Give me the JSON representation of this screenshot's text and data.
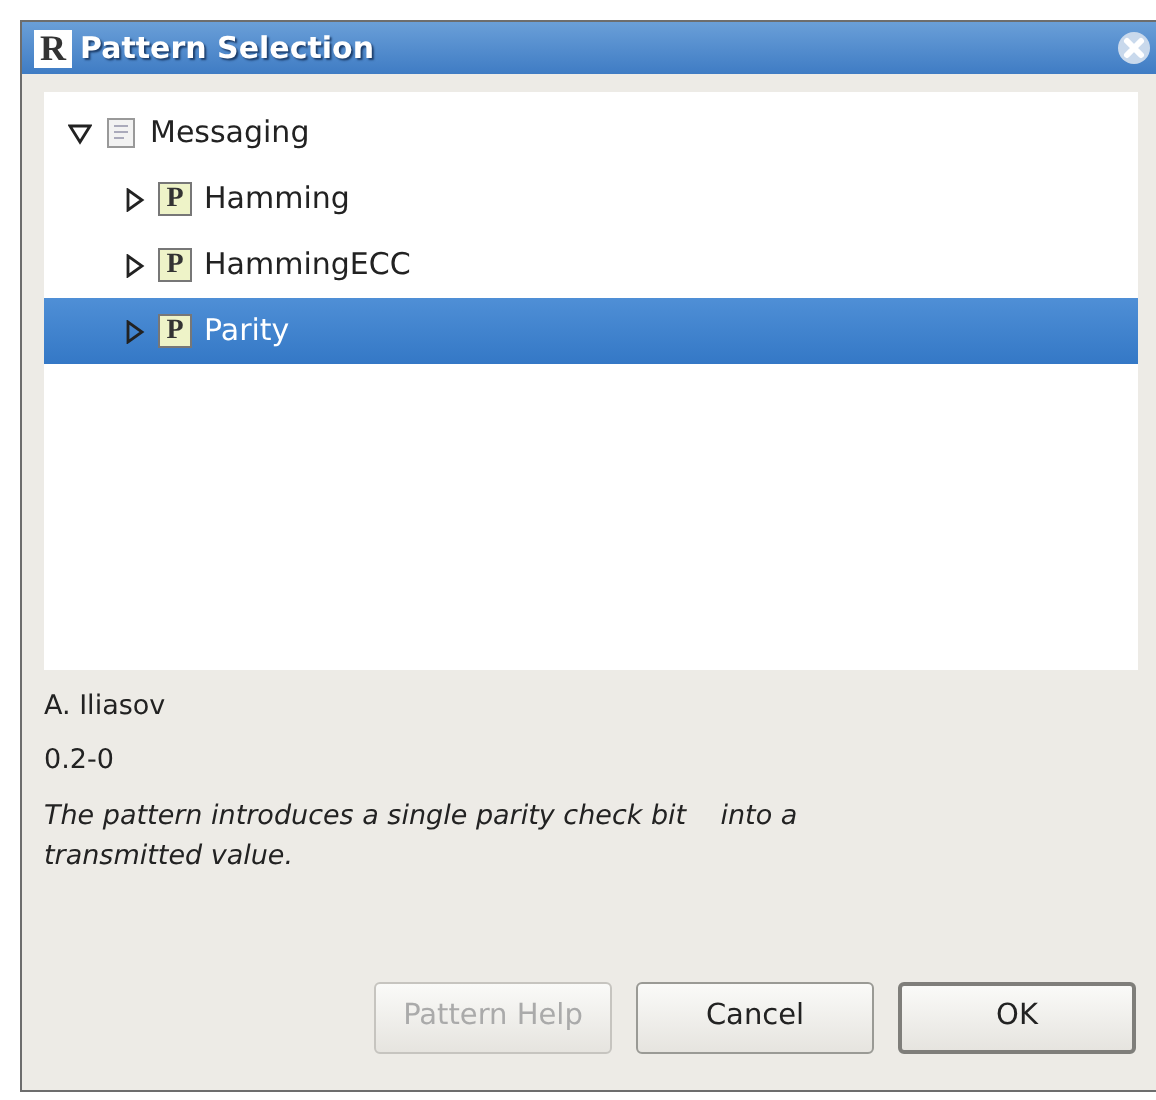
{
  "window": {
    "title": "Pattern Selection",
    "logo": "R"
  },
  "tree": [
    {
      "label": "Messaging",
      "kind": "folder",
      "expanded": true,
      "selected": false,
      "children": [
        {
          "label": "Hamming",
          "kind": "pattern",
          "badge": "P",
          "expanded": false,
          "selected": false
        },
        {
          "label": "HammingECC",
          "kind": "pattern",
          "badge": "P",
          "expanded": false,
          "selected": false
        },
        {
          "label": "Parity",
          "kind": "pattern",
          "badge": "P",
          "expanded": false,
          "selected": true
        }
      ]
    }
  ],
  "details": {
    "author": "A. Iliasov",
    "version": "0.2-0",
    "description": "The pattern introduces a single parity check bit    into a transmitted value."
  },
  "buttons": [
    {
      "label": "Pattern Help",
      "disabled": true,
      "default": false
    },
    {
      "label": "Cancel",
      "disabled": false,
      "default": false
    },
    {
      "label": "OK",
      "disabled": false,
      "default": true
    }
  ]
}
